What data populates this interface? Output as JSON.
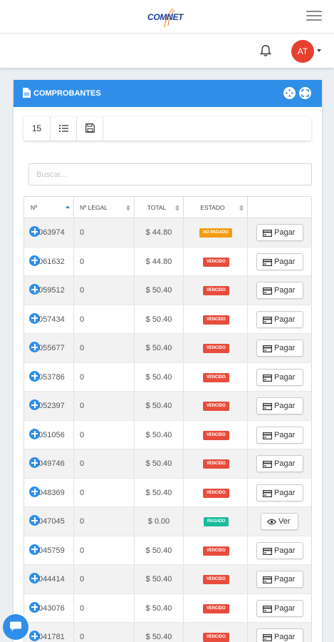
{
  "header": {
    "logo_text": "COMNET",
    "menu_icon": "hamburger-icon",
    "notification_icon": "bell-icon",
    "avatar_initials": "AT",
    "avatar_color": "#e8402f"
  },
  "card": {
    "title": "COMPROBANTES",
    "title_icon": "document-icon",
    "header_color": "#2f8fe8",
    "header_buttons": [
      "collapse-icon",
      "fullscreen-icon"
    ]
  },
  "toolbar": {
    "page_size": "15",
    "columns_icon": "list-icon",
    "export_icon": "save-icon"
  },
  "search": {
    "placeholder": "Buscar..."
  },
  "table": {
    "columns": [
      "Nº",
      "Nº LEGAL",
      "TOTAL",
      "ESTADO",
      ""
    ],
    "rows": [
      {
        "num": "063974",
        "legal": "0",
        "total": "$ 44.80",
        "estado": "NO PAGADO",
        "estado_color": "#f39c12",
        "action": "Pagar",
        "action_icon": "credit-card-icon"
      },
      {
        "num": "061632",
        "legal": "0",
        "total": "$ 44.80",
        "estado": "VENCIDO",
        "estado_color": "#e74c3c",
        "action": "Pagar",
        "action_icon": "credit-card-icon"
      },
      {
        "num": "059512",
        "legal": "0",
        "total": "$ 50.40",
        "estado": "VENCIDO",
        "estado_color": "#e74c3c",
        "action": "Pagar",
        "action_icon": "credit-card-icon"
      },
      {
        "num": "057434",
        "legal": "0",
        "total": "$ 50.40",
        "estado": "VENCIDO",
        "estado_color": "#e74c3c",
        "action": "Pagar",
        "action_icon": "credit-card-icon"
      },
      {
        "num": "055677",
        "legal": "0",
        "total": "$ 50.40",
        "estado": "VENCIDO",
        "estado_color": "#e74c3c",
        "action": "Pagar",
        "action_icon": "credit-card-icon"
      },
      {
        "num": "053786",
        "legal": "0",
        "total": "$ 50.40",
        "estado": "VENCIDO",
        "estado_color": "#e74c3c",
        "action": "Pagar",
        "action_icon": "credit-card-icon"
      },
      {
        "num": "052397",
        "legal": "0",
        "total": "$ 50.40",
        "estado": "VENCIDO",
        "estado_color": "#e74c3c",
        "action": "Pagar",
        "action_icon": "credit-card-icon"
      },
      {
        "num": "051056",
        "legal": "0",
        "total": "$ 50.40",
        "estado": "VENCIDO",
        "estado_color": "#e74c3c",
        "action": "Pagar",
        "action_icon": "credit-card-icon"
      },
      {
        "num": "049746",
        "legal": "0",
        "total": "$ 50.40",
        "estado": "VENCIDO",
        "estado_color": "#e74c3c",
        "action": "Pagar",
        "action_icon": "credit-card-icon"
      },
      {
        "num": "048369",
        "legal": "0",
        "total": "$ 50.40",
        "estado": "VENCIDO",
        "estado_color": "#e74c3c",
        "action": "Pagar",
        "action_icon": "credit-card-icon"
      },
      {
        "num": "047045",
        "legal": "0",
        "total": "$ 0.00",
        "estado": "PAGADO",
        "estado_color": "#1abc9c",
        "action": "Ver",
        "action_icon": "eye-icon"
      },
      {
        "num": "045759",
        "legal": "0",
        "total": "$ 50.40",
        "estado": "VENCIDO",
        "estado_color": "#e74c3c",
        "action": "Pagar",
        "action_icon": "credit-card-icon"
      },
      {
        "num": "044414",
        "legal": "0",
        "total": "$ 50.40",
        "estado": "VENCIDO",
        "estado_color": "#e74c3c",
        "action": "Pagar",
        "action_icon": "credit-card-icon"
      },
      {
        "num": "043076",
        "legal": "0",
        "total": "$ 50.40",
        "estado": "VENCIDO",
        "estado_color": "#e74c3c",
        "action": "Pagar",
        "action_icon": "credit-card-icon"
      },
      {
        "num": "041781",
        "legal": "0",
        "total": "$ 50.40",
        "estado": "VENCIDO",
        "estado_color": "#e74c3c",
        "action": "Pagar",
        "action_icon": "credit-card-icon"
      }
    ]
  },
  "chat": {
    "icon": "chat-icon",
    "color": "#2f8fe8"
  }
}
